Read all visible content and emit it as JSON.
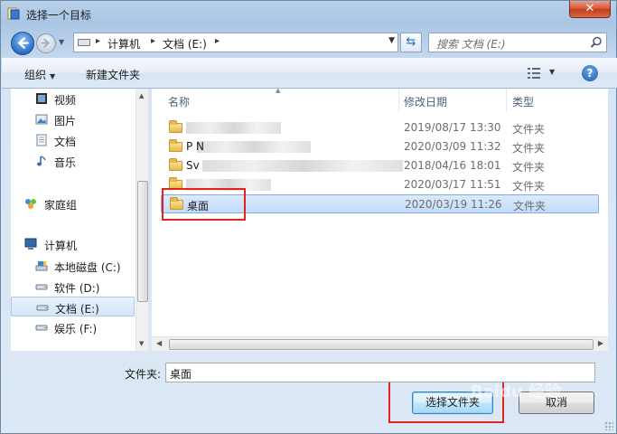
{
  "window": {
    "title": "选择一个目标",
    "close_glyph": "✕"
  },
  "address": {
    "crumbs": [
      "计算机",
      "文档 (E:)"
    ],
    "search_placeholder": "搜索 文档 (E:)"
  },
  "toolbar": {
    "organize": "组织",
    "new_folder": "新建文件夹",
    "help": "?"
  },
  "nav": {
    "items": [
      {
        "label": "视频",
        "icon": "video-icon"
      },
      {
        "label": "图片",
        "icon": "picture-icon"
      },
      {
        "label": "文档",
        "icon": "document-icon"
      },
      {
        "label": "音乐",
        "icon": "music-icon"
      },
      {
        "label": "家庭组",
        "icon": "homegroup-icon"
      },
      {
        "label": "计算机",
        "icon": "computer-icon"
      },
      {
        "label": "本地磁盘 (C:)",
        "icon": "drive-icon"
      },
      {
        "label": "软件 (D:)",
        "icon": "drive-icon"
      },
      {
        "label": "文档 (E:)",
        "icon": "drive-icon"
      },
      {
        "label": "娱乐 (F:)",
        "icon": "drive-icon"
      }
    ],
    "selected_index": 8
  },
  "file_list": {
    "columns": {
      "name": "名称",
      "modified": "修改日期",
      "type": "类型"
    },
    "rows": [
      {
        "name": "",
        "modified": "2019/08/17 13:30",
        "type": "文件夹"
      },
      {
        "name": "P  N",
        "modified": "2020/03/09 11:32",
        "type": "文件夹"
      },
      {
        "name": "Sv",
        "modified": "2018/04/16 18:01",
        "type": "文件夹"
      },
      {
        "name": "",
        "modified": "2020/03/17 11:51",
        "type": "文件夹"
      },
      {
        "name": "桌面",
        "modified": "2020/03/19 11:26",
        "type": "文件夹"
      }
    ],
    "selected_index": 4
  },
  "footer": {
    "folder_label": "文件夹:",
    "folder_value": "桌面",
    "select_button": "选择文件夹",
    "cancel_button": "取消"
  },
  "watermark": "Baidu 经验",
  "colors": {
    "highlight": "#e4231d",
    "selection": "#c1dcfc",
    "accent": "#2a6fc4"
  }
}
